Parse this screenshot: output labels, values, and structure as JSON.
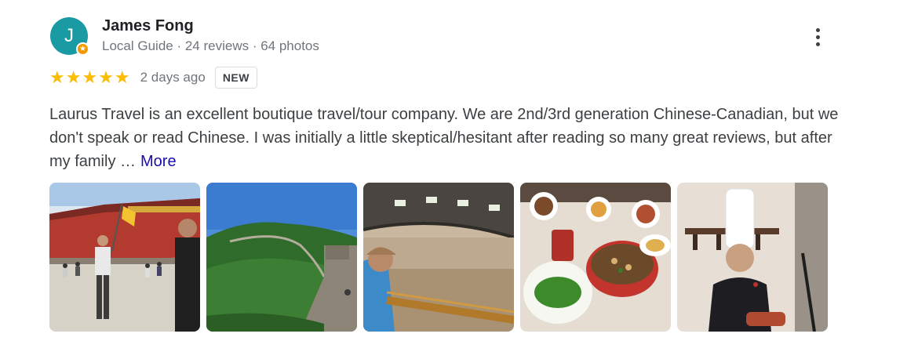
{
  "reviewer": {
    "initial": "J",
    "name": "James Fong",
    "meta": "Local Guide · 24 reviews · 64 photos"
  },
  "rating": {
    "stars": 5,
    "stars_text": "★★★★★",
    "date": "2 days ago",
    "badge": "NEW"
  },
  "review": {
    "text": "Laurus Travel is an excellent boutique travel/tour company. We are 2nd/3rd generation Chinese-Canadian, but we don't speak or read Chinese. I was initially a little skeptical/hesitant after reading so many great reviews, but after my family …",
    "more_label": "More"
  },
  "colors": {
    "avatar": "#1a9aa3",
    "guide_badge": "#f29900",
    "stars": "#fbbc04",
    "link": "#1a0dab"
  },
  "icons": {
    "menu": "more-vert-icon",
    "star": "star-icon",
    "guide": "local-guide-badge-icon"
  }
}
